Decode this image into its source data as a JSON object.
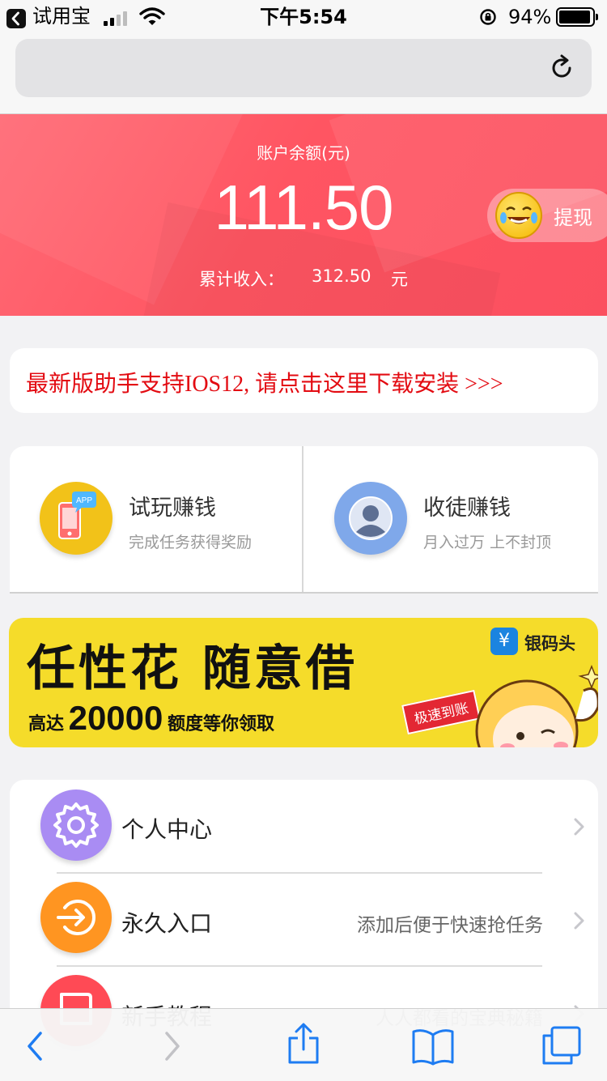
{
  "status_bar": {
    "back_app": "试用宝",
    "time": "下午5:54",
    "battery": "94%"
  },
  "balance": {
    "label": "账户余额(元)",
    "amount": "111.50",
    "income_label": "累计收入：",
    "income_value": "312.50",
    "income_unit": "元",
    "withdraw_label": "提现"
  },
  "notice": {
    "text": "最新版助手支持IOS12, 请点击这里下载安装 >>>"
  },
  "earn": [
    {
      "title": "试玩赚钱",
      "subtitle": "完成任务获得奖励",
      "icon": "phone-app-icon",
      "badge": "APP"
    },
    {
      "title": "收徒赚钱",
      "subtitle": "月入过万 上不封顶",
      "icon": "user-avatar-icon"
    }
  ],
  "ad": {
    "headline": "任性花 随意借",
    "brand": "银码头",
    "subline_prefix": "高达",
    "subline_amount": "20000",
    "subline_suffix": "额度等你领取",
    "tag": "极速到账"
  },
  "menu": [
    {
      "label": "个人中心",
      "hint": "",
      "icon": "gear-icon",
      "color": "#a98cf3"
    },
    {
      "label": "永久入口",
      "hint": "添加后便于快速抢任务",
      "icon": "enter-arrow-icon",
      "color": "#ff9521"
    },
    {
      "label": "新手教程",
      "hint": "人人都看的宝典秘籍",
      "icon": "tutorial-icon",
      "color": "#ff4a55"
    }
  ],
  "colors": {
    "accent_red": "#ff5562",
    "notice_red": "#e30b12",
    "ios_blue": "#1e7cf2",
    "ad_yellow": "#f5dc2a"
  }
}
